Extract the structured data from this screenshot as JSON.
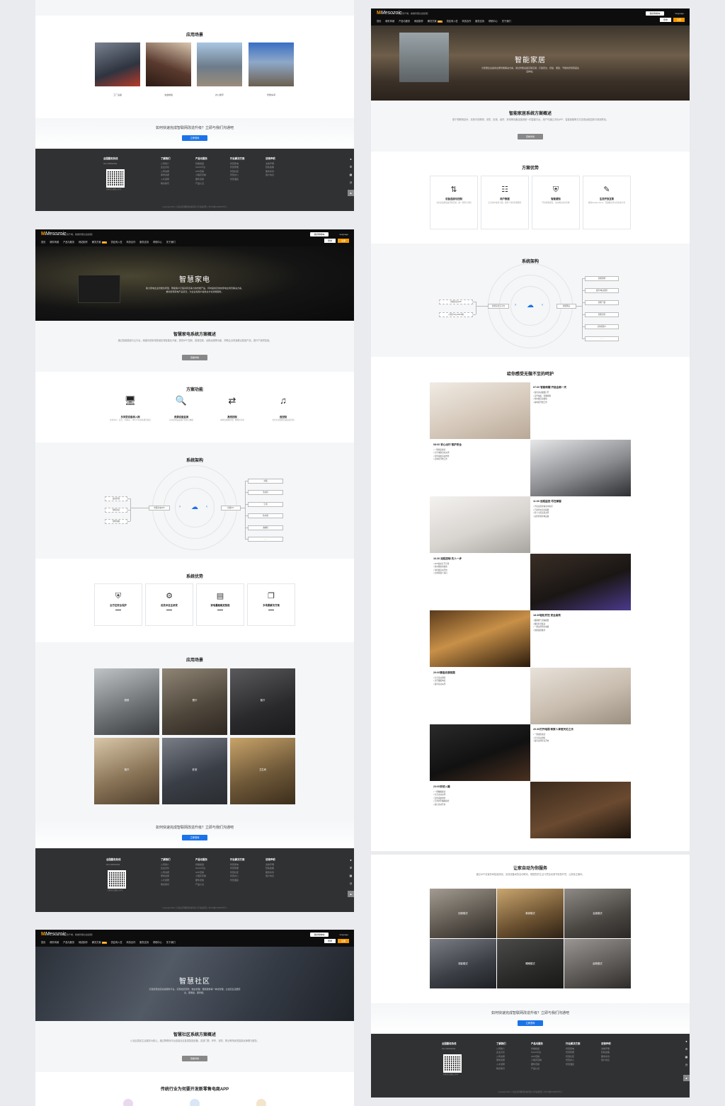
{
  "common": {
    "logo": "Mesozoic",
    "slogan": "从云到千端，助推智能社会赋能！",
    "cart": "我的购物车",
    "lang": "language",
    "login": "登录",
    "register": "注册",
    "menu": [
      "首页",
      "硬件商城",
      "产品与服务",
      "网站制作",
      "解决方案",
      "供应商入驻",
      "商务合作",
      "服务支持",
      "帮助中心",
      "关于我们"
    ],
    "hot": "HOT",
    "detail": "查看详情",
    "cta": "如何快速完成智联网改造升级？立即与我们沟通吧",
    "cta_btn": "立即咨询",
    "footer": {
      "hotline_title": "全国服务热线",
      "phone": "021-59562092",
      "qr_caption": "扫码关注微信公众号",
      "cols": [
        {
          "title": "了解我们",
          "items": [
            "公司简介",
            "企业文化",
            "公司资质",
            "荣誉资质",
            "人才招聘",
            "联系我们"
          ]
        },
        {
          "title": "产品与服务",
          "items": [
            "智能模组",
            "SAAS平台",
            "APP定制",
            "小程序定制",
            "硬件定制",
            "产品认证"
          ]
        },
        {
          "title": "行业解决方案",
          "items": [
            "智慧家电",
            "智慧家居",
            "智慧社区",
            "智慧办公",
            "智慧酒店"
          ]
        },
        {
          "title": "法律声明",
          "items": [
            "法律声明",
            "隐私政策",
            "服务条款",
            "用户协议"
          ]
        }
      ],
      "copyright": "Copyright 2021 上海麦多科网络科技有限公司 版权所有 | 沪ICP备12345678号-1"
    }
  },
  "panel_a": {
    "scene_title": "应用场景",
    "scenes": [
      "工厂设备",
      "冶金制造",
      "办公楼宇",
      "智能车间"
    ]
  },
  "panel_b": {
    "hero_title": "智慧家电",
    "hero_sub": "助力家电企业智能化转型，帮助客户打造具有竞争力的智能产品，同时提供高效的家电全场景解决方案，推动智慧家电产品普及，为企业和用户提供全方位智能服务。",
    "overview_title": "智慧家电系统方案概述",
    "overview_text": "通过智能模组与云平台，赋能传统家电快速实现智能化升级，提供APP控制、语音控制、远程运维等功能，帮助企业快速推出智能产品，提升产品附加值。",
    "func_title": "方案功能",
    "funcs": [
      {
        "icon": "🖥",
        "name": "多类型设备接入网",
        "desc": "支持WiFi、蓝牙、ZigBee、NB-IoT等多种通讯协议"
      },
      {
        "icon": "🔍",
        "name": "资源设备监测",
        "desc": "实时监测设备运行状态与数据"
      },
      {
        "icon": "⇄",
        "name": "离线控制",
        "desc": "本地局域网控制，断网也可用"
      },
      {
        "icon": "♫",
        "name": "音控制",
        "desc": "支持主流智能音箱语音控制"
      }
    ],
    "arch_title": "系统架构",
    "arch_left": [
      "运动控制",
      "智能语音",
      "智能电视"
    ],
    "arch_mid_left": "智能家电APP",
    "arch_mid_right": "智能IOT",
    "arch_right": [
      "冰箱",
      "洗衣机",
      "空调",
      "热水器",
      "油烟机",
      "......"
    ],
    "adv_title": "系统优势",
    "advs": [
      {
        "icon": "⛨",
        "name": "全方位安全保护"
      },
      {
        "icon": "⚙",
        "name": "前技术自主研发"
      },
      {
        "icon": "▤",
        "name": "家电量贩稳定智能"
      },
      {
        "icon": "❐",
        "name": "多场景解决方案"
      }
    ],
    "scene_title": "应用场景",
    "scenes": [
      "厨房",
      "餐厅",
      "客厅",
      "客厅",
      "卧室",
      "卫生间"
    ]
  },
  "panel_c": {
    "hero_title": "智慧社区",
    "hero_sub": "打造智慧社区综合服务平台，实现社区安防、物业管理、便民服务等一体化管理，让社区生活更安全、更便捷、更智能。",
    "overview_title": "智慧社区系统方案概述",
    "overview_text": "以社区居民生活服务为核心，通过物联网平台连接社区各类智能设备，实现门禁、停车、安防、物业等场景的智能化管理与服务。",
    "app_title": "传统行业为何要开发新零售电商APP"
  },
  "panel_d": {
    "hero_title": "智能家居",
    "hero_sub": "为家居企业提供全屋智能解决方案，通过智能设备互联互通，打造安全、舒适、便捷、节能的智慧家庭生活体验。",
    "overview_title": "智能家居系统方案概述",
    "overview_text": "基于物联网技术，将家中的照明、安防、影音、窗帘、家电等设备连接到统一的智能平台，用户可通过手机APP、智能音箱等方式实现远程控制与场景联动。",
    "adv_title": "方案优势",
    "advs": [
      {
        "icon": "⇅",
        "name": "设备连接与控制",
        "desc": "支持多品牌设备互联互通，统一管理与控制"
      },
      {
        "icon": "☷",
        "name": "用户数据",
        "desc": "记录用户使用习惯，提供个性化智能服务"
      },
      {
        "icon": "⛨",
        "name": "智能感知",
        "desc": "环境智能感知，主动响应用户需求"
      },
      {
        "icon": "✎",
        "name": "生态开放互联",
        "desc": "兼容Google Home、天猫精灵等主流生态平台"
      }
    ],
    "arch_title": "系统架构",
    "arch_left": [
      "智能家居APP",
      "小程序/App/Web端"
    ],
    "arch_mid_left": "智能家居云平台",
    "arch_mid_right": "智能网关",
    "arch_right": [
      "智能照明",
      "窗帘/电动窗帘",
      "智能门锁",
      "智能安防",
      "扫地机器人",
      "......"
    ],
    "care_title": "给你感受无微不至的呵护",
    "timeline": [
      {
        "time": "07:00  智能唤醒 开启全新一天",
        "items": [
          "窗帘自动缓缓打开",
          "音乐响起，温馨唤醒",
          "热水器自动加热",
          "咖啡机开始工作"
        ]
      },
      {
        "time": "08:00  安心出行 智护安全",
        "items": [
          "一键离家模式",
          "灯光电器自动关闭",
          "安防系统自动布防",
          "扫地机开始工作"
        ]
      },
      {
        "time": "11:00  远程监控 尽在掌握",
        "items": [
          "手机远程查看家中情况",
          "门窗异常实时提醒",
          "老人小孩远程关怀",
          "远程控制家电设备"
        ]
      },
      {
        "time": "16:30  远程控制 先人一步",
        "items": [
          "APP提前打开空调",
          "热水器提前加热",
          "净化器自动开启",
          "扫地机器人清扫"
        ]
      },
      {
        "time": "18:30轻松烹饪 安全高效",
        "items": [
          "烟雾燃气泄漏报警",
          "烟机灶具联动",
          "一键关闭所有电器",
          "智能菜谱推荐"
        ]
      },
      {
        "time": "20:00营造浪漫氛围",
        "items": [
          "灯光自动调暗",
          "音乐缓缓响起",
          "窗帘自动关闭"
        ]
      },
      {
        "time": "20:30打开电视 和家人享受天伦之乐",
        "items": [
          "一键观影模式",
          "灯光自动调暗",
          "窗帘关闭影音开启"
        ]
      },
      {
        "time": "23:00安然入睡",
        "items": [
          "一键睡眠模式",
          "灯光自动关闭",
          "安防系统布防",
          "空调调至睡眠模式",
          "夜灯自动开启"
        ]
      }
    ],
    "service_title": "让家自动为你服务",
    "service_text": "通过APP设置多种智能场景，实现设备间的自动联动，根据您的生活习惯自动调节家居环境，让家真正懂你。",
    "services": [
      "回家模式",
      "离家模式",
      "会客模式",
      "观影模式",
      "睡眠模式",
      "起夜模式"
    ]
  }
}
